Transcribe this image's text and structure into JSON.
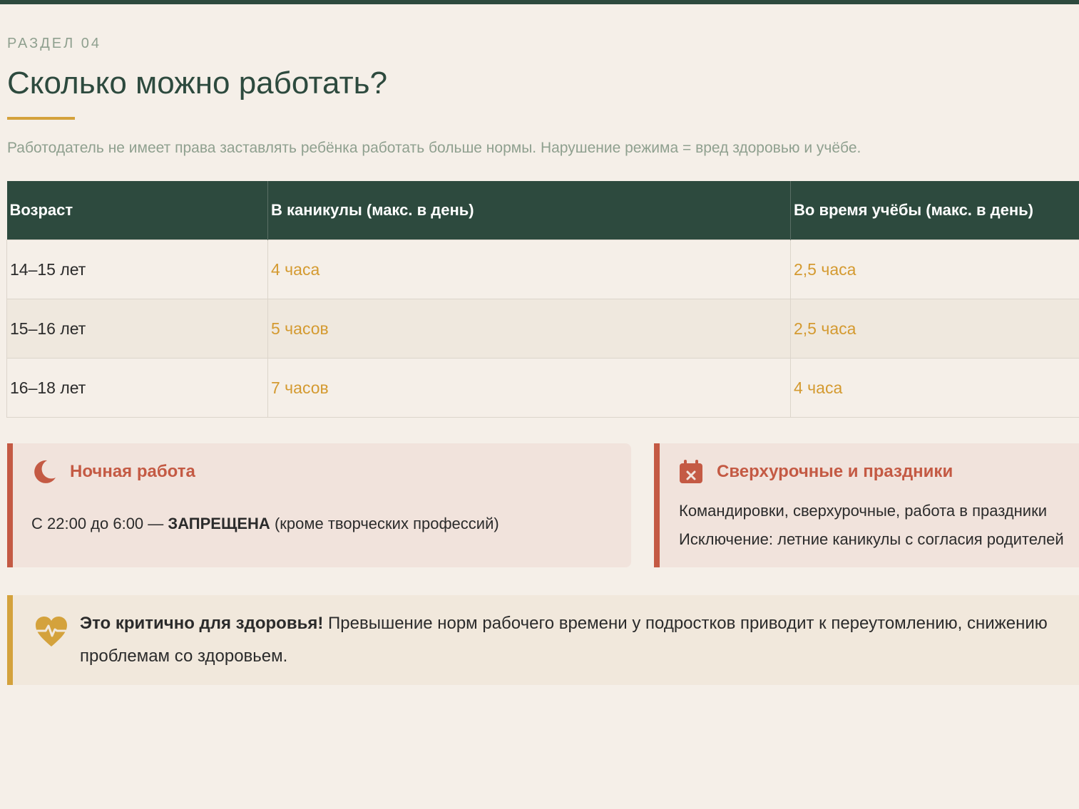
{
  "section": {
    "label": "РАЗДЕЛ 04",
    "title": "Сколько можно работать?",
    "intro": "Работодатель не имеет права заставлять ребёнка работать больше нормы. Нарушение режима = вред здоровью и учёбе."
  },
  "table": {
    "headers": [
      "Возраст",
      "В каникулы (макс. в день)",
      "Во время учёбы (макс. в день)"
    ],
    "rows": [
      {
        "age": "14–15 лет",
        "holidays": "4 часа",
        "school": "2,5 часа"
      },
      {
        "age": "15–16 лет",
        "holidays": "5 часов",
        "school": "2,5 часа"
      },
      {
        "age": "16–18 лет",
        "holidays": "7 часов",
        "school": "4 часа"
      }
    ]
  },
  "cards": {
    "night": {
      "icon": "moon-icon",
      "title": "Ночная работа",
      "text_before": "С 22:00 до 6:00 — ",
      "text_strong": "ЗАПРЕЩЕНА",
      "text_after": " (кроме творческих профессий)"
    },
    "overtime": {
      "icon": "calendar-x-icon",
      "title": "Сверхурочные и праздники",
      "line1": "Командировки, сверхурочные, работа в праздники",
      "line2": "Исключение: летние каникулы с согласия родителей"
    }
  },
  "alert": {
    "icon": "heart-pulse-icon",
    "strong": "Это критично для здоровья!",
    "text": " Превышение норм рабочего времени у подростков приводит к переутомлению, снижению",
    "line2": "проблемам со здоровьем."
  },
  "colors": {
    "primary": "#2d4a3e",
    "accent": "#d4a23c",
    "danger": "#c45a44",
    "muted": "#8fa08f",
    "background": "#f5efe8"
  }
}
